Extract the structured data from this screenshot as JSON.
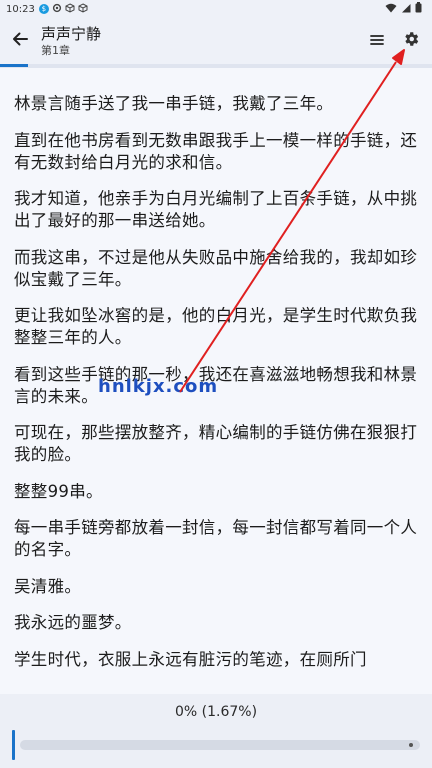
{
  "status_bar": {
    "time": "10:23"
  },
  "app_bar": {
    "back_icon": "arrow-left-icon",
    "book_title": "声声宁静",
    "chapter": "第1章",
    "menu_icon": "hamburger-menu-icon",
    "settings_icon": "gear-icon"
  },
  "content": {
    "paragraphs": [
      "林景言随手送了我一串手链，我戴了三年。",
      "直到在他书房看到无数串跟我手上一模一样的手链，还有无数封给白月光的求和信。",
      "我才知道，他亲手为白月光编制了上百条手链，从中挑出了最好的那一串送给她。",
      "而我这串，不过是他从失败品中施舍给我的，我却如珍似宝戴了三年。",
      "更让我如坠冰窖的是，他的白月光，是学生时代欺负我整整三年的人。",
      "看到这些手链的那一秒，我还在喜滋滋地畅想我和林景言的未来。",
      "可现在，那些摆放整齐，精心编制的手链仿佛在狠狠打我的脸。",
      "整整99串。",
      "每一串手链旁都放着一封信，每一封信都写着同一个人的名字。",
      "吴清雅。",
      "我永远的噩梦。",
      "学生时代，衣服上永远有脏污的笔迹，在厕所门"
    ]
  },
  "watermark": "hnlkjx.com",
  "progress": {
    "label": "0% (1.67%)",
    "fraction": 0.0167
  },
  "colors": {
    "accent": "#1a73c9",
    "annotation_arrow": "#e02020"
  }
}
